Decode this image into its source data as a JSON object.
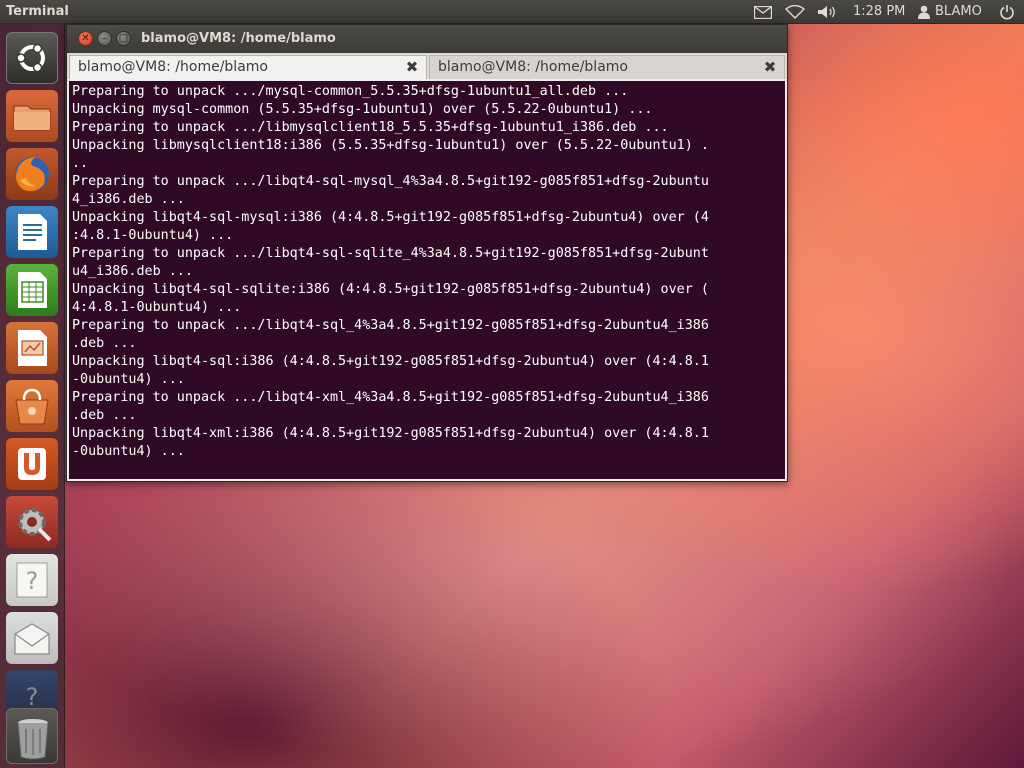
{
  "panel": {
    "app_title": "Terminal",
    "clock": "1:28 PM",
    "user": "BLAMO",
    "icons": [
      "mail-icon",
      "wifi-icon",
      "volume-icon",
      "user-icon"
    ]
  },
  "launcher": {
    "items": [
      {
        "name": "dash-home",
        "icon": "ubuntu-logo-icon"
      },
      {
        "name": "files",
        "icon": "folder-icon"
      },
      {
        "name": "firefox",
        "icon": "firefox-icon"
      },
      {
        "name": "libreoffice-writer",
        "icon": "writer-icon"
      },
      {
        "name": "libreoffice-calc",
        "icon": "calc-icon"
      },
      {
        "name": "libreoffice-impress",
        "icon": "impress-icon"
      },
      {
        "name": "software-center",
        "icon": "software-center-icon"
      },
      {
        "name": "ubuntu-one",
        "icon": "ubuntu-one-icon"
      },
      {
        "name": "system-settings",
        "icon": "settings-icon"
      },
      {
        "name": "help",
        "icon": "help-icon"
      },
      {
        "name": "mail",
        "icon": "mail-app-icon"
      },
      {
        "name": "unknown-app",
        "icon": "unknown-app-icon"
      },
      {
        "name": "trash",
        "icon": "trash-icon"
      }
    ]
  },
  "window": {
    "title": "blamo@VM8: /home/blamo",
    "tabs": [
      {
        "label": "blamo@VM8: /home/blamo",
        "active": true
      },
      {
        "label": "blamo@VM8: /home/blamo",
        "active": false
      }
    ],
    "close_glyph": "✖"
  },
  "terminal": {
    "background": "#300a24",
    "foreground": "#ffffff",
    "lines": [
      "Preparing to unpack .../mysql-common_5.5.35+dfsg-1ubuntu1_all.deb ...",
      "Unpacking mysql-common (5.5.35+dfsg-1ubuntu1) over (5.5.22-0ubuntu1) ...",
      "Preparing to unpack .../libmysqlclient18_5.5.35+dfsg-1ubuntu1_i386.deb ...",
      "Unpacking libmysqlclient18:i386 (5.5.35+dfsg-1ubuntu1) over (5.5.22-0ubuntu1) .",
      "..",
      "Preparing to unpack .../libqt4-sql-mysql_4%3a4.8.5+git192-g085f851+dfsg-2ubuntu",
      "4_i386.deb ...",
      "Unpacking libqt4-sql-mysql:i386 (4:4.8.5+git192-g085f851+dfsg-2ubuntu4) over (4",
      ":4.8.1-0ubuntu4) ...",
      "Preparing to unpack .../libqt4-sql-sqlite_4%3a4.8.5+git192-g085f851+dfsg-2ubunt",
      "u4_i386.deb ...",
      "Unpacking libqt4-sql-sqlite:i386 (4:4.8.5+git192-g085f851+dfsg-2ubuntu4) over (",
      "4:4.8.1-0ubuntu4) ...",
      "Preparing to unpack .../libqt4-sql_4%3a4.8.5+git192-g085f851+dfsg-2ubuntu4_i386",
      ".deb ...",
      "Unpacking libqt4-sql:i386 (4:4.8.5+git192-g085f851+dfsg-2ubuntu4) over (4:4.8.1",
      "-0ubuntu4) ...",
      "Preparing to unpack .../libqt4-xml_4%3a4.8.5+git192-g085f851+dfsg-2ubuntu4_i386",
      ".deb ...",
      "Unpacking libqt4-xml:i386 (4:4.8.5+git192-g085f851+dfsg-2ubuntu4) over (4:4.8.1",
      "-0ubuntu4) ..."
    ]
  }
}
